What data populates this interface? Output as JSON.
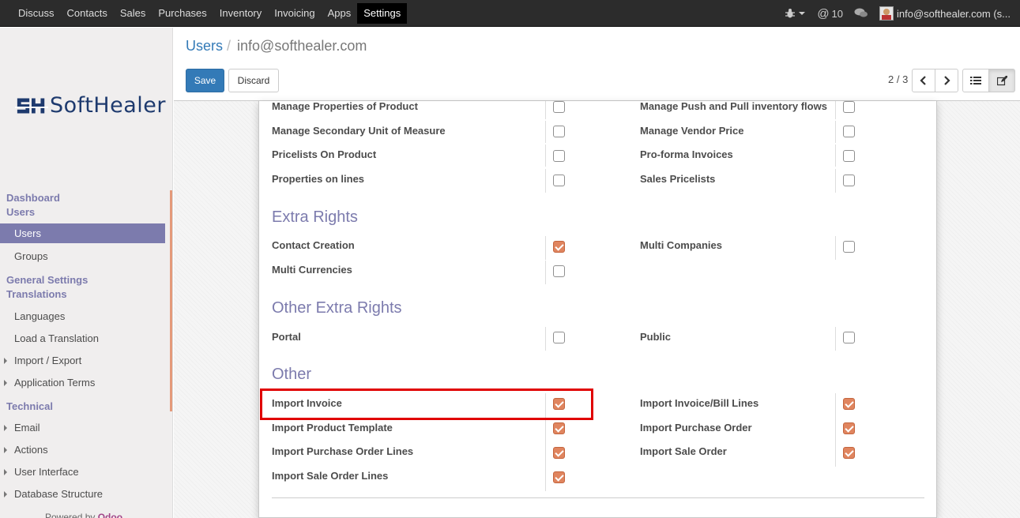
{
  "topbar": {
    "menu": [
      "Discuss",
      "Contacts",
      "Sales",
      "Purchases",
      "Inventory",
      "Invoicing",
      "Apps",
      "Settings"
    ],
    "active_menu": "Settings",
    "notification_count": "10",
    "user_label": "info@softhealer.com (s..."
  },
  "sidebar": {
    "logo_text": "SoftHealer",
    "sections": [
      {
        "label": "Dashboard"
      },
      {
        "label": "Users",
        "items": [
          {
            "label": "Users",
            "active": true
          },
          {
            "label": "Groups"
          }
        ]
      },
      {
        "label": "General Settings"
      },
      {
        "label": "Translations",
        "items": [
          {
            "label": "Languages"
          },
          {
            "label": "Load a Translation"
          },
          {
            "label": "Import / Export"
          },
          {
            "label": "Application Terms"
          }
        ]
      },
      {
        "label": "Technical",
        "items": [
          {
            "label": "Email"
          },
          {
            "label": "Actions"
          },
          {
            "label": "User Interface"
          },
          {
            "label": "Database Structure"
          }
        ]
      }
    ],
    "powered_prefix": "Powered by",
    "powered_brand": "Odoo"
  },
  "breadcrumb": {
    "parent": "Users",
    "separator": "/",
    "current": "info@softhealer.com"
  },
  "buttons": {
    "save": "Save",
    "discard": "Discard"
  },
  "pager": {
    "value": "2 / 3"
  },
  "form": {
    "top_rows": [
      {
        "left": {
          "label": "Manage Properties of Product",
          "checked": false
        },
        "right": {
          "label": "Manage Push and Pull inventory flows",
          "checked": false
        }
      },
      {
        "left": {
          "label": "Manage Secondary Unit of Measure",
          "checked": false
        },
        "right": {
          "label": "Manage Vendor Price",
          "checked": false
        }
      },
      {
        "left": {
          "label": "Pricelists On Product",
          "checked": false
        },
        "right": {
          "label": "Pro-forma Invoices",
          "checked": false
        }
      },
      {
        "left": {
          "label": "Properties on lines",
          "checked": false
        },
        "right": {
          "label": "Sales Pricelists",
          "checked": false
        }
      }
    ],
    "extra_rights": {
      "title": "Extra Rights",
      "rows": [
        {
          "left": {
            "label": "Contact Creation",
            "checked": true
          },
          "right": {
            "label": "Multi Companies",
            "checked": false
          }
        },
        {
          "left": {
            "label": "Multi Currencies",
            "checked": false
          }
        }
      ]
    },
    "other_extra_rights": {
      "title": "Other Extra Rights",
      "rows": [
        {
          "left": {
            "label": "Portal",
            "checked": false
          },
          "right": {
            "label": "Public",
            "checked": false
          }
        }
      ]
    },
    "other": {
      "title": "Other",
      "rows": [
        {
          "left": {
            "label": "Import Invoice",
            "checked": true
          },
          "right": {
            "label": "Import Invoice/Bill Lines",
            "checked": true
          }
        },
        {
          "left": {
            "label": "Import Product Template",
            "checked": true
          },
          "right": {
            "label": "Import Purchase Order",
            "checked": true
          }
        },
        {
          "left": {
            "label": "Import Purchase Order Lines",
            "checked": true
          },
          "right": {
            "label": "Import Sale Order",
            "checked": true
          }
        },
        {
          "left": {
            "label": "Import Sale Order Lines",
            "checked": true
          }
        }
      ]
    }
  },
  "colors": {
    "accent": "#7c7bad",
    "checkbox_checked": "#e0855f",
    "highlight": "#e00000",
    "primary": "#337ab7"
  }
}
